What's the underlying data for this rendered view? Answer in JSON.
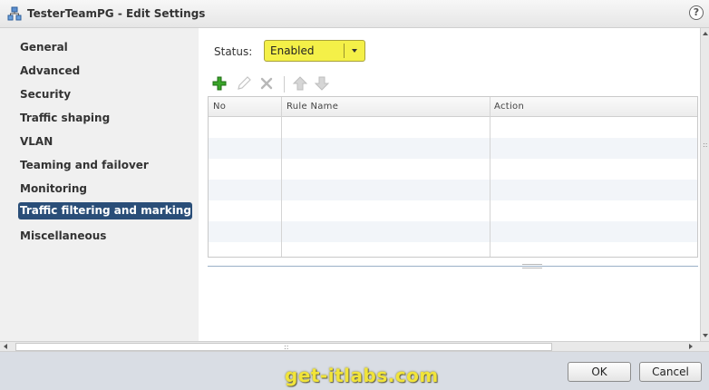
{
  "window": {
    "title": "TesterTeamPG - Edit Settings",
    "help_label": "?"
  },
  "sidebar": {
    "items": [
      {
        "label": "General",
        "active": false
      },
      {
        "label": "Advanced",
        "active": false
      },
      {
        "label": "Security",
        "active": false
      },
      {
        "label": "Traffic shaping",
        "active": false
      },
      {
        "label": "VLAN",
        "active": false
      },
      {
        "label": "Teaming and failover",
        "active": false
      },
      {
        "label": "Monitoring",
        "active": false
      },
      {
        "label": "Traffic filtering and marking",
        "active": true
      },
      {
        "label": "Miscellaneous",
        "active": false
      }
    ]
  },
  "main": {
    "status": {
      "label": "Status:",
      "value": "Enabled"
    },
    "toolbar": {
      "icons": [
        "add-icon",
        "edit-icon",
        "delete-icon",
        "move-up-icon",
        "move-down-icon"
      ]
    },
    "table": {
      "columns": [
        "No",
        "Rule Name",
        "Action"
      ],
      "rows": []
    }
  },
  "footer": {
    "watermark": "get-itlabs.com",
    "ok_label": "OK",
    "cancel_label": "Cancel"
  },
  "colors": {
    "accent": "#2a4e78",
    "status_highlight": "#f4f048",
    "add_icon": "#3aa52a"
  }
}
